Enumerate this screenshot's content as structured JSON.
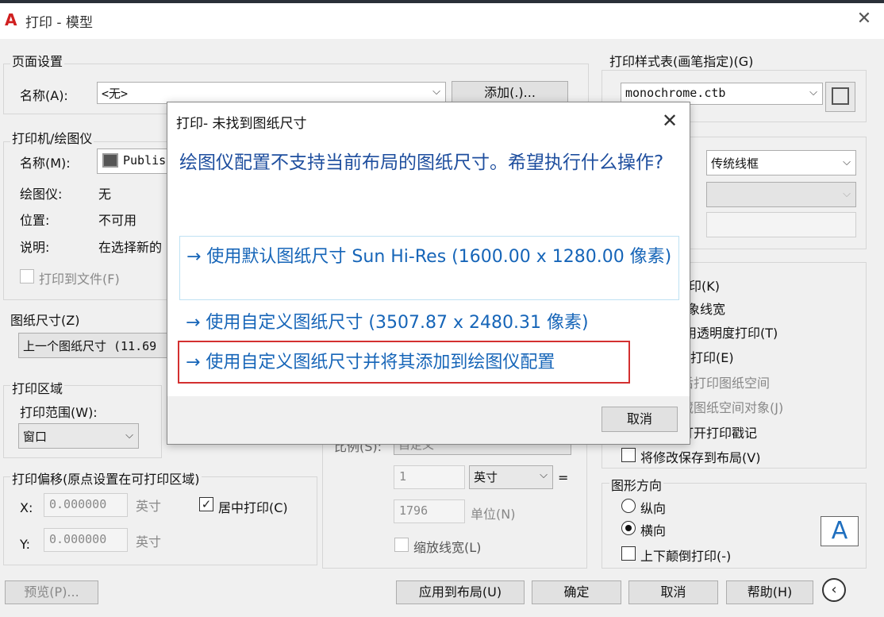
{
  "window": {
    "title": "打印 - 模型",
    "app_icon": "autocad-icon"
  },
  "page_setup": {
    "group": "页面设置",
    "name_label": "名称(A):",
    "name_value": "<无>",
    "add_button": "添加(.)..."
  },
  "printer": {
    "group": "打印机/绘图仪",
    "name_label": "名称(M):",
    "name_value": "Publis",
    "plotter_label": "绘图仪:",
    "plotter_value": "无",
    "location_label": "位置:",
    "location_value": "不可用",
    "desc_label": "说明:",
    "desc_value": "在选择新的",
    "print_to_file": "打印到文件(F)"
  },
  "paper": {
    "group": "图纸尺寸(Z)",
    "value": "上一个图纸尺寸 (11.69"
  },
  "plot_area": {
    "group": "打印区域",
    "range_label": "打印范围(W):",
    "range_value": "窗口"
  },
  "offset": {
    "group": "打印偏移(原点设置在可打印区域)",
    "x_label": "X:",
    "x_value": "0.000000",
    "x_unit": "英寸",
    "y_label": "Y:",
    "y_value": "0.000000",
    "y_unit": "英寸",
    "center": "居中打印(C)"
  },
  "scale": {
    "scale_label": "比例(S):",
    "scale_value": "自定义",
    "value1": "1",
    "unit_value": "英寸",
    "value2": "1796",
    "unit_label": "单位(N)",
    "lineweight": "缩放线宽(L)"
  },
  "style_table": {
    "group": "打印样式表(画笔指定)(G)",
    "value": "monochrome.ctb"
  },
  "shade": {
    "mode_value": "传统线框"
  },
  "options": {
    "items": [
      "印(K)",
      "象线宽",
      "用透明度打印(T)",
      "打印(E)",
      "后打印图纸空间",
      "藏图纸空间对象(J)",
      "打开打印戳记",
      "将修改保存到布局(V)"
    ]
  },
  "orientation": {
    "group": "图形方向",
    "portrait": "纵向",
    "landscape": "横向",
    "upside": "上下颠倒打印(-)"
  },
  "bottom": {
    "preview": "预览(P)...",
    "apply": "应用到布局(U)",
    "ok": "确定",
    "cancel": "取消",
    "help": "帮助(H)"
  },
  "dialog": {
    "title": "打印- 未找到图纸尺寸",
    "message": "绘图仪配置不支持当前布局的图纸尺寸。希望执行什么操作?",
    "option1": "→ 使用默认图纸尺寸 Sun Hi-Res (1600.00 x 1280.00 像素)",
    "option2": "→ 使用自定义图纸尺寸 (3507.87 x 2480.31 像素)",
    "option3": "→ 使用自定义图纸尺寸并将其添加到绘图仪配置",
    "cancel": "取消"
  }
}
